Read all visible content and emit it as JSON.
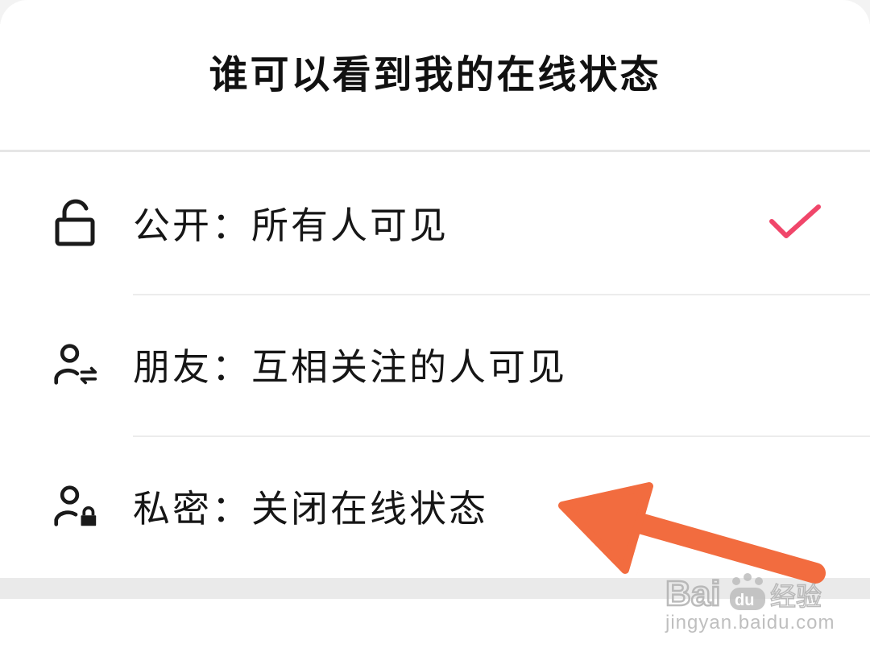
{
  "sheet": {
    "title": "谁可以看到我的在线状态",
    "options": [
      {
        "label": "公开：所有人可见",
        "icon": "unlock-icon",
        "selected": true
      },
      {
        "label": "朋友：互相关注的人可见",
        "icon": "user-mutual-icon",
        "selected": false
      },
      {
        "label": "私密：关闭在线状态",
        "icon": "user-lock-icon",
        "selected": false
      }
    ]
  },
  "colors": {
    "check": "#f0466a",
    "arrow": "#f26c3f",
    "text": "#161616",
    "divider": "#ececec"
  },
  "watermark": {
    "brand": "Baidu经验",
    "url": "jingyan.baidu.com"
  }
}
